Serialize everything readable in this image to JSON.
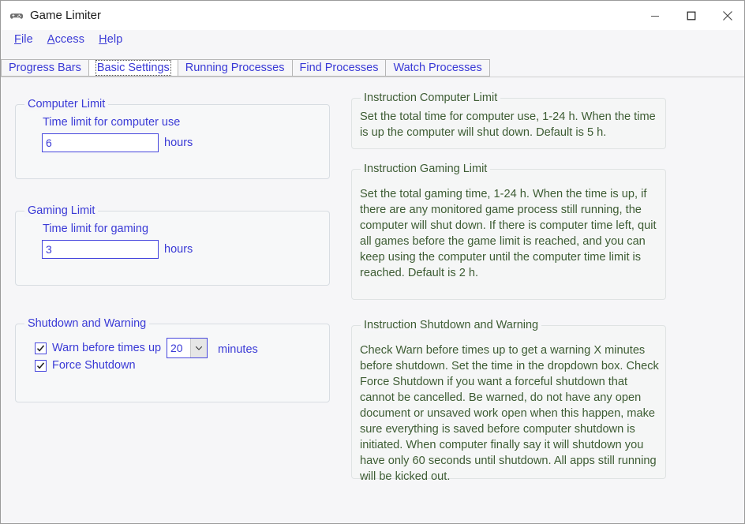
{
  "window": {
    "title": "Game Limiter",
    "icon": "gamepad-icon",
    "minimize_label": "—",
    "maximize_label": "□",
    "close_label": "✕"
  },
  "menubar": {
    "items": [
      {
        "label": "File",
        "accel": "F",
        "rest": "ile"
      },
      {
        "label": "Access",
        "accel": "A",
        "rest": "ccess"
      },
      {
        "label": "Help",
        "accel": "H",
        "rest": "elp"
      }
    ]
  },
  "tabs": {
    "selected": "Basic Settings",
    "items": [
      {
        "label": "Progress Bars"
      },
      {
        "label": "Basic Settings"
      },
      {
        "label": "Running Processes"
      },
      {
        "label": "Find Processes"
      },
      {
        "label": "Watch Processes"
      }
    ]
  },
  "computer_limit": {
    "group_title": "Computer Limit",
    "field_label": "Time limit for computer use",
    "value": "6",
    "unit": "hours"
  },
  "gaming_limit": {
    "group_title": "Gaming Limit",
    "field_label": "Time limit for gaming",
    "value": "3",
    "unit": "hours"
  },
  "shutdown_warning": {
    "group_title": "Shutdown and Warning",
    "warn_checkbox": {
      "label": "Warn before times up",
      "checked": true
    },
    "force_checkbox": {
      "label": "Force Shutdown",
      "checked": true
    },
    "minutes_dropdown": {
      "value": "20",
      "unit": "minutes"
    }
  },
  "instructions": {
    "computer_limit": {
      "title": "Instruction Computer Limit",
      "text": "Set the total time for computer use, 1-24 h. When the time is up the computer will shut down. Default is 5 h."
    },
    "gaming_limit": {
      "title": "Instruction Gaming Limit",
      "text": "Set the total gaming time, 1-24 h. When the time is up, if there are any monitored game process still running, the computer will shut down. If there is computer time left, quit all games before the game limit is reached, and you can keep using the computer until the computer time limit is reached. Default is 2 h."
    },
    "shutdown_warning": {
      "title": "Instruction Shutdown and Warning",
      "text": "Check Warn before times up to get a warning X minutes before shutdown. Set the time in the dropdown box. Check Force Shutdown if you want a forceful shutdown that cannot be cancelled. Be warned, do not have any open document or unsaved work open when this happen, make sure everything is saved before computer shutdown is initiated. When computer finally say it will shutdown you have only 60 seconds until shutdown. All apps still running will be kicked out."
    }
  },
  "colors": {
    "accent_blue": "#3a3ad6",
    "instruction_green": "#3d5c33",
    "window_bg": "#f6f6f8",
    "group_bg": "#f7f8f9"
  }
}
